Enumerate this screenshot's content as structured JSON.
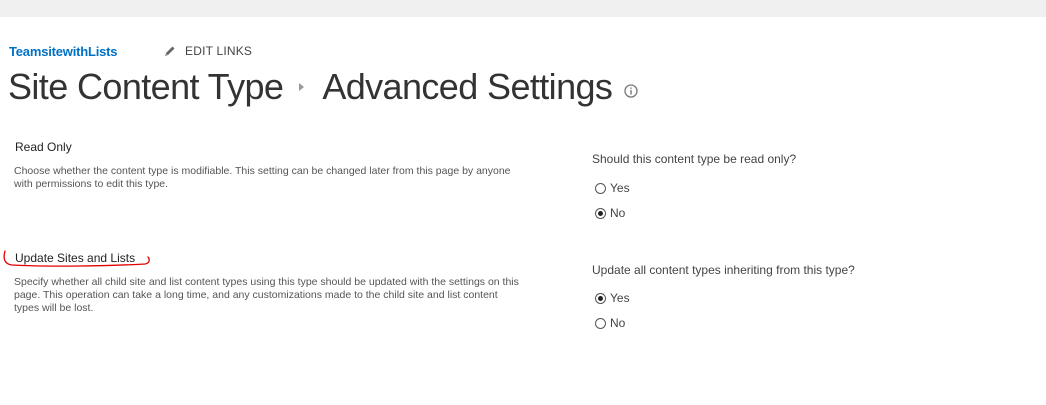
{
  "header": {
    "site_link": "TeamsitewithLists",
    "edit_links": "EDIT LINKS"
  },
  "page": {
    "title_part1": "Site Content Type",
    "title_part2": "Advanced Settings"
  },
  "sections": [
    {
      "title": "Read Only",
      "description": "Choose whether the content type is modifiable. This setting can be changed later from this page by anyone with permissions to edit this type.",
      "question": "Should this content type be read only?",
      "options": [
        {
          "label": "Yes",
          "checked": false
        },
        {
          "label": "No",
          "checked": true
        }
      ]
    },
    {
      "title": "Update Sites and Lists",
      "description": "Specify whether all child site and list content types using this type should be updated with the settings on this page. This operation can take a long time, and any customizations made to the child site and list content types will be lost.",
      "question": "Update all content types inheriting from this type?",
      "options": [
        {
          "label": "Yes",
          "checked": true
        },
        {
          "label": "No",
          "checked": false
        }
      ]
    }
  ],
  "colors": {
    "link": "#0072c6",
    "annotation": "#e00000",
    "topbar": "#f0f0f0"
  },
  "icons": {
    "edit": "pencil-icon",
    "info": "info-icon"
  }
}
